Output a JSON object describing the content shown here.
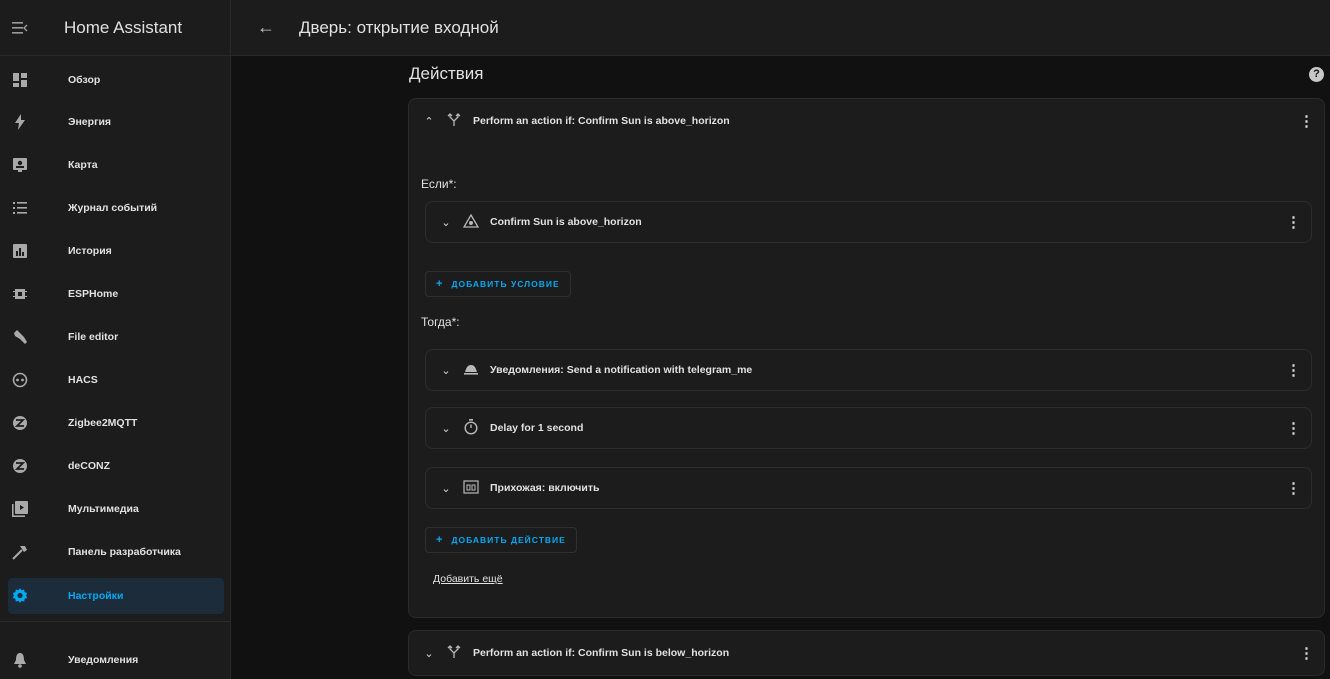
{
  "app": {
    "title": "Home Assistant",
    "menu_icon": "menu-icon"
  },
  "topbar": {
    "back_icon": "arrow-left-icon",
    "title": "Дверь: открытие входной"
  },
  "sidebar": {
    "items": [
      {
        "label": "Обзор",
        "icon": "dashboard-icon",
        "active": false
      },
      {
        "label": "Энергия",
        "icon": "lightning-icon",
        "active": false
      },
      {
        "label": "Карта",
        "icon": "map-icon",
        "active": false
      },
      {
        "label": "Журнал событий",
        "icon": "list-icon",
        "active": false
      },
      {
        "label": "История",
        "icon": "chart-icon",
        "active": false
      },
      {
        "label": "ESPHome",
        "icon": "chip-icon",
        "active": false
      },
      {
        "label": "File editor",
        "icon": "wrench-icon",
        "active": false
      },
      {
        "label": "HACS",
        "icon": "hacs-icon",
        "active": false
      },
      {
        "label": "Zigbee2MQTT",
        "icon": "zigbee-icon",
        "active": false
      },
      {
        "label": "deCONZ",
        "icon": "zigbee-icon",
        "active": false
      },
      {
        "label": "Мультимедиа",
        "icon": "media-icon",
        "active": false
      },
      {
        "label": "Панель разработчика",
        "icon": "hammer-icon",
        "active": false
      },
      {
        "label": "Настройки",
        "icon": "gear-icon",
        "active": true
      }
    ],
    "notifications": {
      "label": "Уведомления",
      "icon": "bell-icon"
    }
  },
  "main": {
    "section_title": "Действия",
    "help_icon": "help-icon",
    "help_glyph": "?",
    "action1": {
      "label": "Perform an action if: Confirm Sun is above_horizon",
      "if_label": "Если*:",
      "condition": {
        "label": "Confirm Sun is above_horizon",
        "icon": "sun-horizon-icon"
      },
      "add_condition": "ДОБАВИТЬ УСЛОВИЕ",
      "then_label": "Тогда*:",
      "then_items": [
        {
          "label": "Уведомления: Send a notification with telegram_me",
          "icon": "bell-icon"
        },
        {
          "label": "Delay for 1 second",
          "icon": "timer-icon"
        },
        {
          "label": "Прихожая: включить",
          "icon": "light-switch-icon"
        }
      ],
      "add_action": "ДОБАВИТЬ ДЕЙСТВИЕ",
      "add_more": "Добавить ещё"
    },
    "action2": {
      "label": "Perform an action if: Confirm Sun is below_horizon"
    }
  }
}
